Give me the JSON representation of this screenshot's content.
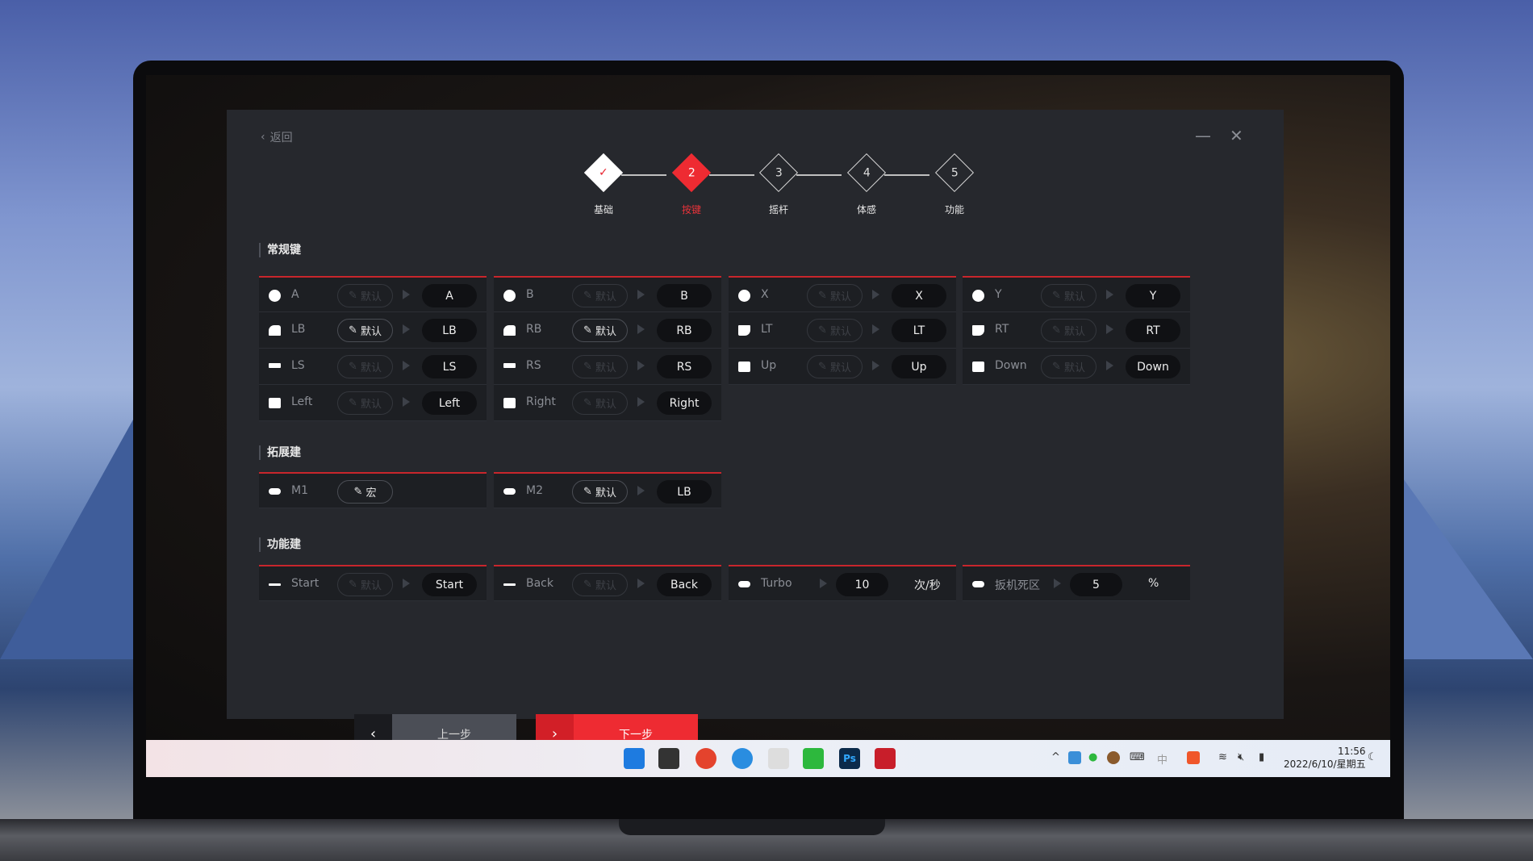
{
  "header": {
    "back_label": "返回",
    "minimize_icon": "minimize-icon",
    "close_icon": "close-icon"
  },
  "steps": [
    {
      "num": "",
      "label": "基础",
      "state": "done"
    },
    {
      "num": "2",
      "label": "按键",
      "state": "current"
    },
    {
      "num": "3",
      "label": "摇杆",
      "state": "pending"
    },
    {
      "num": "4",
      "label": "体感",
      "state": "pending"
    },
    {
      "num": "5",
      "label": "功能",
      "state": "pending"
    }
  ],
  "sections": {
    "regular": "常规键",
    "extended": "拓展建",
    "function": "功能建"
  },
  "regular_keys": [
    {
      "icon": "circle",
      "label": "A",
      "edit": "默认",
      "edit_active": false,
      "value": "A"
    },
    {
      "icon": "circle",
      "label": "B",
      "edit": "默认",
      "edit_active": false,
      "value": "B"
    },
    {
      "icon": "circle",
      "label": "X",
      "edit": "默认",
      "edit_active": false,
      "value": "X"
    },
    {
      "icon": "circle",
      "label": "Y",
      "edit": "默认",
      "edit_active": false,
      "value": "Y"
    },
    {
      "icon": "bump",
      "label": "LB",
      "edit": "默认",
      "edit_active": true,
      "value": "LB"
    },
    {
      "icon": "bump",
      "label": "RB",
      "edit": "默认",
      "edit_active": true,
      "value": "RB"
    },
    {
      "icon": "trig",
      "label": "LT",
      "edit": "默认",
      "edit_active": false,
      "value": "LT"
    },
    {
      "icon": "trig",
      "label": "RT",
      "edit": "默认",
      "edit_active": false,
      "value": "RT"
    },
    {
      "icon": "stick",
      "label": "LS",
      "edit": "默认",
      "edit_active": false,
      "value": "LS"
    },
    {
      "icon": "stick",
      "label": "RS",
      "edit": "默认",
      "edit_active": false,
      "value": "RS"
    },
    {
      "icon": "sq",
      "label": "Up",
      "edit": "默认",
      "edit_active": false,
      "value": "Up"
    },
    {
      "icon": "sq",
      "label": "Down",
      "edit": "默认",
      "edit_active": false,
      "value": "Down"
    },
    {
      "icon": "sq",
      "label": "Left",
      "edit": "默认",
      "edit_active": false,
      "value": "Left"
    },
    {
      "icon": "sq",
      "label": "Right",
      "edit": "默认",
      "edit_active": false,
      "value": "Right"
    }
  ],
  "extended_keys": [
    {
      "icon": "pill",
      "label": "M1",
      "edit": "宏",
      "edit_active": true,
      "value": ""
    },
    {
      "icon": "pill",
      "label": "M2",
      "edit": "默认",
      "edit_active": true,
      "value": "LB"
    }
  ],
  "function_keys": [
    {
      "icon": "dash",
      "label": "Start",
      "edit": "默认",
      "value": "Start"
    },
    {
      "icon": "dash",
      "label": "Back",
      "edit": "默认",
      "value": "Back"
    },
    {
      "icon": "pill",
      "label": "Turbo",
      "value": "10",
      "unit": "次/秒"
    },
    {
      "icon": "pill",
      "label": "扳机死区",
      "value": "5",
      "unit": "%"
    }
  ],
  "nav": {
    "prev": "上一步",
    "next": "下一步"
  },
  "colors": {
    "accent": "#ee2b32",
    "panel": "#26282d",
    "cell": "#1d1f23"
  },
  "taskbar": {
    "apps": [
      "windows-start-icon",
      "task-view-icon",
      "chrome-icon",
      "edge-icon",
      "file-icon",
      "wechat-icon",
      "photoshop-icon",
      "gamepad-app-icon"
    ],
    "photoshop_label": "Ps",
    "tray_ime": "中",
    "time": "11:56",
    "date": "2022/6/10/星期五"
  }
}
